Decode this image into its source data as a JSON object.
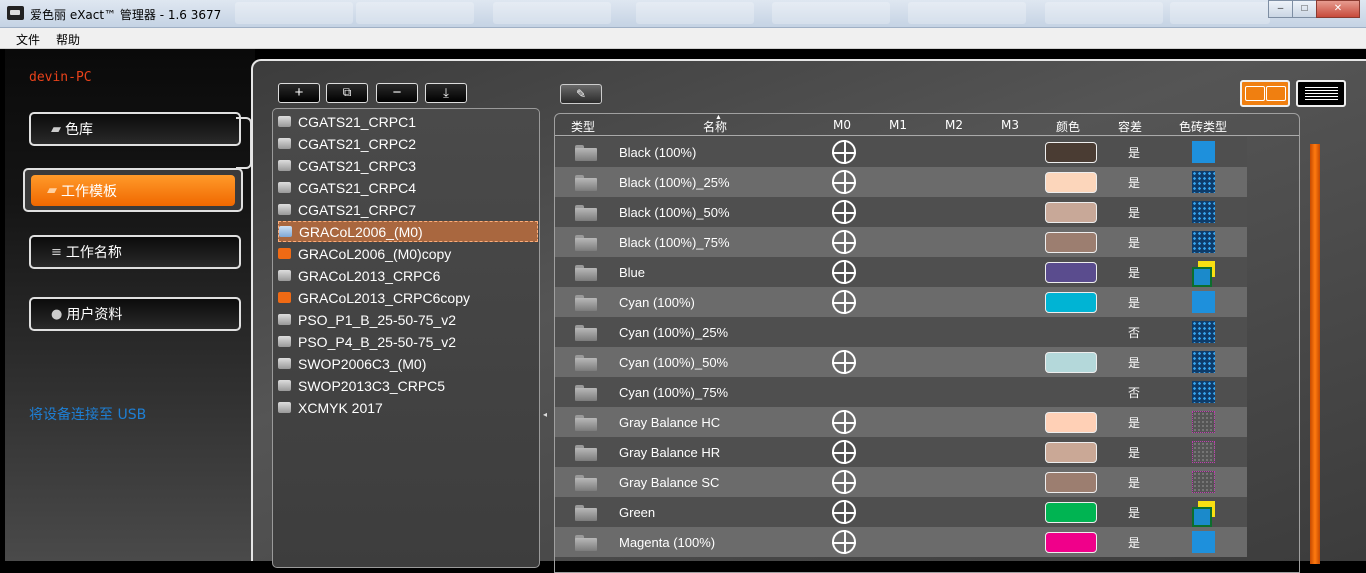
{
  "window": {
    "title": "爱色丽 eXact™ 管理器 - 1.6  3677"
  },
  "menu": {
    "file": "文件",
    "help": "帮助"
  },
  "sidebar": {
    "pc_name": "devin-PC",
    "items": [
      {
        "label": "色库",
        "icon": "palette-icon"
      },
      {
        "label": "工作模板",
        "icon": "template-icon"
      },
      {
        "label": "工作名称",
        "icon": "database-icon"
      },
      {
        "label": "用户资料",
        "icon": "user-icon"
      }
    ],
    "connect_link": "将设备连接至 USB"
  },
  "toolbar": {
    "add": "+",
    "copy": "⧉",
    "remove": "−",
    "export": "⤓",
    "edit": "✎"
  },
  "templates": [
    {
      "name": "CGATS21_CRPC1",
      "icon": "gray"
    },
    {
      "name": "CGATS21_CRPC2",
      "icon": "gray"
    },
    {
      "name": "CGATS21_CRPC3",
      "icon": "gray"
    },
    {
      "name": "CGATS21_CRPC4",
      "icon": "gray"
    },
    {
      "name": "CGATS21_CRPC7",
      "icon": "gray"
    },
    {
      "name": "GRACoL2006_(M0)",
      "icon": "blue",
      "selected": true
    },
    {
      "name": "GRACoL2006_(M0)copy",
      "icon": "orange"
    },
    {
      "name": "GRACoL2013_CRPC6",
      "icon": "gray"
    },
    {
      "name": "GRACoL2013_CRPC6copy",
      "icon": "orange"
    },
    {
      "name": "PSO_P1_B_25-50-75_v2",
      "icon": "gray"
    },
    {
      "name": "PSO_P4_B_25-50-75_v2",
      "icon": "gray"
    },
    {
      "name": "SWOP2006C3_(M0)",
      "icon": "gray"
    },
    {
      "name": "SWOP2013C3_CRPC5",
      "icon": "gray"
    },
    {
      "name": "XCMYK 2017",
      "icon": "gray"
    }
  ],
  "table": {
    "headers": {
      "type": "类型",
      "name": "名称",
      "m0": "M0",
      "m1": "M1",
      "m2": "M2",
      "m3": "M3",
      "color": "颜色",
      "tolerance": "容差",
      "patch_type": "色砖类型"
    },
    "rows": [
      {
        "name": "Black (100%)",
        "m0": true,
        "color": "#4a3c33",
        "tol": "是",
        "ptype": "solid"
      },
      {
        "name": "Black (100%)_25%",
        "m0": true,
        "color": "#fcd6bb",
        "tol": "是",
        "ptype": "dots"
      },
      {
        "name": "Black (100%)_50%",
        "m0": true,
        "color": "#c8a898",
        "tol": "是",
        "ptype": "dots"
      },
      {
        "name": "Black (100%)_75%",
        "m0": true,
        "color": "#9c7e70",
        "tol": "是",
        "ptype": "dots"
      },
      {
        "name": "Blue",
        "m0": true,
        "color": "#5a4c8e",
        "tol": "是",
        "ptype": "overlap"
      },
      {
        "name": "Cyan (100%)",
        "m0": true,
        "color": "#00b4d4",
        "tol": "是",
        "ptype": "solid"
      },
      {
        "name": "Cyan (100%)_25%",
        "m0": false,
        "color": "",
        "tol": "否",
        "ptype": "dots"
      },
      {
        "name": "Cyan (100%)_50%",
        "m0": true,
        "color": "#b4d8da",
        "tol": "是",
        "ptype": "dots"
      },
      {
        "name": "Cyan (100%)_75%",
        "m0": false,
        "color": "",
        "tol": "否",
        "ptype": "dots"
      },
      {
        "name": "Gray Balance HC",
        "m0": true,
        "color": "#ffd0b6",
        "tol": "是",
        "ptype": "gray"
      },
      {
        "name": "Gray Balance HR",
        "m0": true,
        "color": "#caa896",
        "tol": "是",
        "ptype": "gray"
      },
      {
        "name": "Gray Balance SC",
        "m0": true,
        "color": "#9c7e70",
        "tol": "是",
        "ptype": "gray"
      },
      {
        "name": "Green",
        "m0": true,
        "color": "#00b452",
        "tol": "是",
        "ptype": "overlap"
      },
      {
        "name": "Magenta (100%)",
        "m0": true,
        "color": "#f0008a",
        "tol": "是",
        "ptype": "solid"
      }
    ]
  }
}
